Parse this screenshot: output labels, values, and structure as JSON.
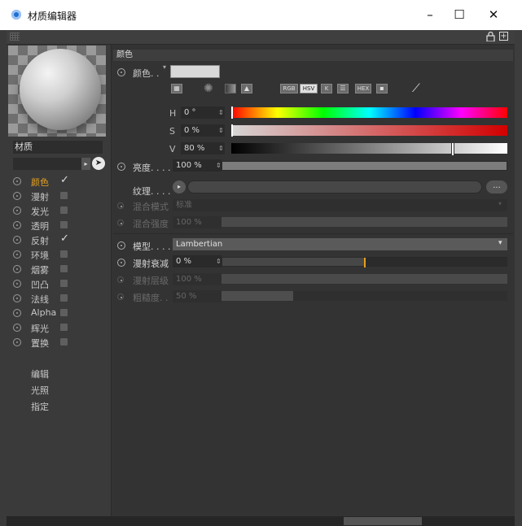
{
  "window": {
    "title": "材质编辑器",
    "minimize": "–",
    "maximize": "☐",
    "close": "✕"
  },
  "toolbar": {
    "lock_icon": "lock-icon",
    "expand_icon": "expand-icon"
  },
  "material": {
    "name": "材质"
  },
  "channels": [
    {
      "label": "颜色",
      "enabled": true,
      "active": true
    },
    {
      "label": "漫射",
      "enabled": false
    },
    {
      "label": "发光",
      "enabled": false
    },
    {
      "label": "透明",
      "enabled": false
    },
    {
      "label": "反射",
      "enabled": true
    },
    {
      "label": "环境",
      "enabled": false
    },
    {
      "label": "烟雾",
      "enabled": false
    },
    {
      "label": "凹凸",
      "enabled": false
    },
    {
      "label": "法线",
      "enabled": false
    },
    {
      "label": "Alpha",
      "enabled": false
    },
    {
      "label": "辉光",
      "enabled": false
    },
    {
      "label": "置换",
      "enabled": false
    }
  ],
  "extra_items": [
    "编辑",
    "光照",
    "指定"
  ],
  "section": {
    "title": "颜色"
  },
  "color": {
    "label": "颜色. .",
    "swatch": "#d9d9d9",
    "modes": [
      "RGB",
      "HSV",
      "K",
      "HEX"
    ],
    "h": {
      "label": "H",
      "value": "0 °"
    },
    "s": {
      "label": "S",
      "value": "0 %"
    },
    "v": {
      "label": "V",
      "value": "80 %",
      "level": 0.8
    }
  },
  "brightness": {
    "label": "亮度. . . .",
    "value": "100 %",
    "level": 1.0
  },
  "texture": {
    "label": "纹理. . . .",
    "more": "..."
  },
  "mix_mode": {
    "label": "混合模式",
    "value": "标准"
  },
  "mix_strength": {
    "label": "混合强度",
    "value": "100 %"
  },
  "model": {
    "label": "模型. . . .",
    "value": "Lambertian"
  },
  "diffuse_falloff": {
    "label": "漫射衰减",
    "value": "0 %",
    "level": 0.5
  },
  "diffuse_level": {
    "label": "漫射层级",
    "value": "100 %"
  },
  "roughness": {
    "label": "粗糙度. .",
    "value": "50 %",
    "level": 0.25
  },
  "colors": {
    "accent": "#e6a020",
    "panel": "#333333"
  }
}
